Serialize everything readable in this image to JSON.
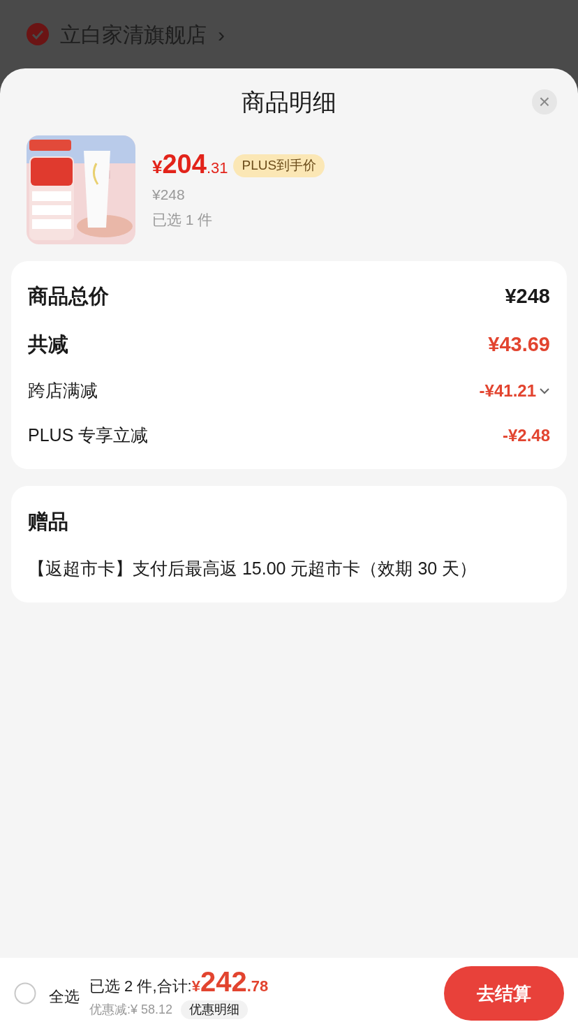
{
  "store": {
    "name": "立白家清旗舰店",
    "chevron": "›",
    "checked": true
  },
  "sheet": {
    "title": "商品明细",
    "close": "×"
  },
  "product": {
    "price_symbol": "¥",
    "price_int": "204",
    "price_dec": ".31",
    "badge": "PLUS到手价",
    "original_price": "¥248",
    "selected_count": "已选 1 件"
  },
  "summary": [
    {
      "kind": "major",
      "label": "商品总价",
      "value": "¥248",
      "red": false,
      "expandable": false
    },
    {
      "kind": "major",
      "label": "共减",
      "value": "¥43.69",
      "red": true,
      "expandable": false
    },
    {
      "kind": "minor",
      "label": "跨店满减",
      "value": "-¥41.21",
      "red": true,
      "expandable": true
    },
    {
      "kind": "minor",
      "label": "PLUS 专享立减",
      "value": "-¥2.48",
      "red": true,
      "expandable": false
    }
  ],
  "gift": {
    "title": "赠品",
    "text": "【返超市卡】支付后最高返 15.00 元超市卡（效期 30 天）"
  },
  "footer": {
    "select_all": {
      "label": "全选",
      "checked": false
    },
    "total_prefix": "已选 2 件,合计:",
    "total_symbol": "¥",
    "total_int": "242",
    "total_dec": ".78",
    "discount": "优惠减:¥ 58.12",
    "detail_button": "优惠明细",
    "checkout": "去结算"
  }
}
